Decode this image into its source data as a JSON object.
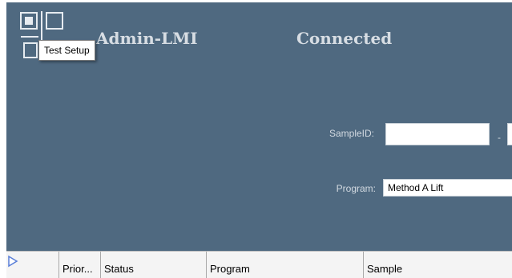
{
  "header": {
    "user_name": "Admin-LMI",
    "connection_status": "Connected",
    "app_icon": "test-setup-icon",
    "tooltip": "Test Setup"
  },
  "form": {
    "sample_id_label": "SampleID:",
    "sample_id_value": "",
    "sample_id_separator": "-",
    "program_label": "Program:",
    "program_selected": "Method A Lift"
  },
  "grid": {
    "columns": [
      "",
      "Prior...",
      "Status",
      "Program",
      "Sample"
    ],
    "run_icon": "play-arrow-icon"
  },
  "colors": {
    "panel_background": "#4f6980",
    "header_text": "#d7dde3",
    "accent_icon": "#5a7fd8"
  }
}
